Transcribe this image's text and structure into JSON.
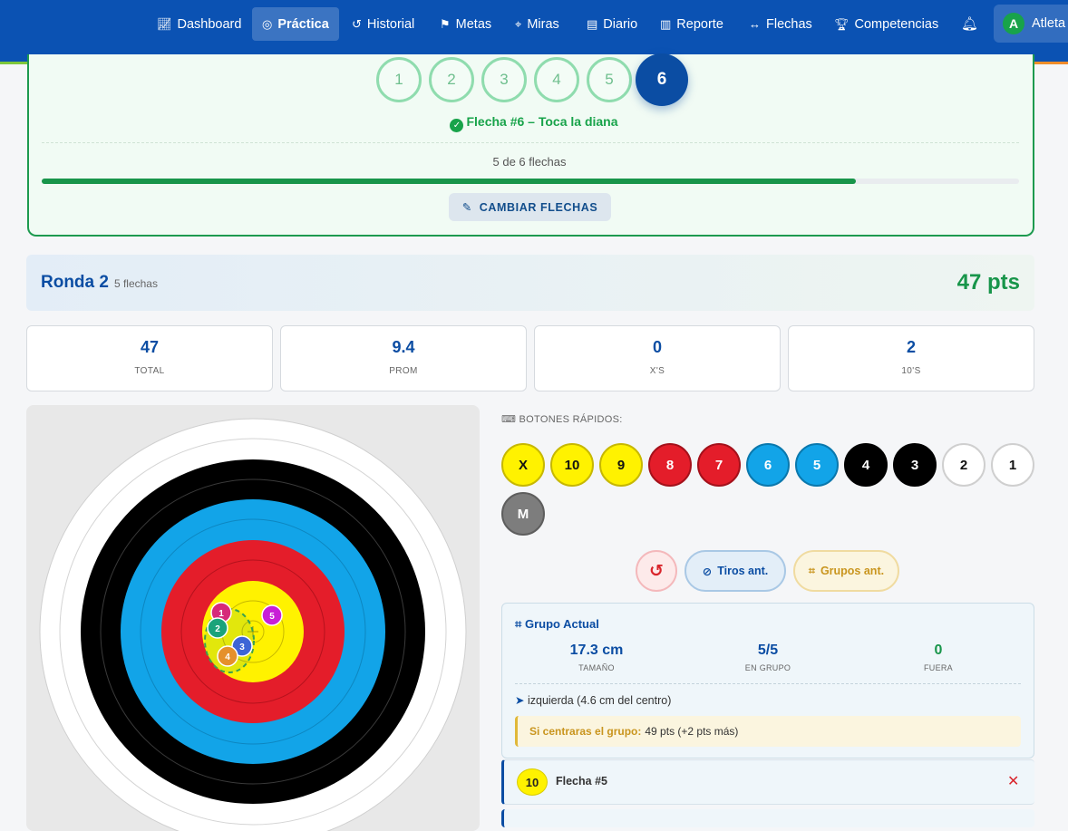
{
  "nav": {
    "items": [
      {
        "label": "Dashboard",
        "icon": "chart-line-icon"
      },
      {
        "label": "Práctica",
        "icon": "target-icon",
        "active": true
      },
      {
        "label": "Historial",
        "icon": "history-icon"
      },
      {
        "label": "Metas",
        "icon": "flag-checkered-icon"
      },
      {
        "label": "Miras",
        "icon": "crosshairs-icon"
      },
      {
        "label": "Diario",
        "icon": "book-icon"
      },
      {
        "label": "Reporte",
        "icon": "chart-bar-icon"
      },
      {
        "label": "Flechas",
        "icon": "arrows-horizontal-icon"
      },
      {
        "label": "Competencias",
        "icon": "trophy-icon"
      }
    ],
    "user": {
      "initial": "A",
      "name": "Atleta"
    }
  },
  "arrow_selector": {
    "arrows": [
      "1",
      "2",
      "3",
      "4",
      "5",
      "6"
    ],
    "current_index": 5,
    "status": "Flecha #6 – Toca la diana",
    "progress_text": "5 de 6 flechas",
    "progress_fraction": 0.833,
    "change_button": "CAMBIAR FLECHAS"
  },
  "round": {
    "title": "Ronda 2",
    "subtitle": "5 flechas",
    "points": "47 pts"
  },
  "stats": [
    {
      "value": "47",
      "label": "TOTAL"
    },
    {
      "value": "9.4",
      "label": "PROM"
    },
    {
      "value": "0",
      "label": "X'S"
    },
    {
      "value": "2",
      "label": "10'S"
    }
  ],
  "target": {
    "shots": [
      {
        "label": "1",
        "color": "#d6297a"
      },
      {
        "label": "2",
        "color": "#1aa37a"
      },
      {
        "label": "3",
        "color": "#3d65d6"
      },
      {
        "label": "4",
        "color": "#e5902b"
      },
      {
        "label": "5",
        "color": "#c81fd6"
      }
    ]
  },
  "quick_buttons": {
    "label": "BOTONES RÁPIDOS:",
    "buttons": [
      {
        "label": "X",
        "bg": "#fff200",
        "border": "#c7b800",
        "fg": "#111"
      },
      {
        "label": "10",
        "bg": "#fff200",
        "border": "#c7b800",
        "fg": "#111"
      },
      {
        "label": "9",
        "bg": "#fff200",
        "border": "#c7b800",
        "fg": "#111"
      },
      {
        "label": "8",
        "bg": "#e41d2a",
        "border": "#a4111b",
        "fg": "#fff"
      },
      {
        "label": "7",
        "bg": "#e41d2a",
        "border": "#a4111b",
        "fg": "#fff"
      },
      {
        "label": "6",
        "bg": "#12a4e8",
        "border": "#0a78ad",
        "fg": "#fff"
      },
      {
        "label": "5",
        "bg": "#12a4e8",
        "border": "#0a78ad",
        "fg": "#fff"
      },
      {
        "label": "4",
        "bg": "#000000",
        "border": "#000000",
        "fg": "#fff"
      },
      {
        "label": "3",
        "bg": "#000000",
        "border": "#000000",
        "fg": "#fff"
      },
      {
        "label": "2",
        "bg": "#ffffff",
        "border": "#cfcfcf",
        "fg": "#111"
      },
      {
        "label": "1",
        "bg": "#ffffff",
        "border": "#cfcfcf",
        "fg": "#111"
      },
      {
        "label": "M",
        "bg": "#7d7d7d",
        "border": "#5e5e5e",
        "fg": "#fff"
      }
    ]
  },
  "tools": {
    "undo_icon": "undo-icon",
    "prev_shots": "Tiros ant.",
    "prev_groups": "Grupos ant."
  },
  "group": {
    "title": "Grupo Actual",
    "size": {
      "value": "17.3 cm",
      "label": "TAMAÑO",
      "color": "#0b4da3"
    },
    "in_group": {
      "value": "5/5",
      "label": "EN GRUPO",
      "color": "#0b4da3"
    },
    "outside": {
      "value": "0",
      "label": "FUERA",
      "color": "#18954a"
    },
    "direction": "izquierda (4.6 cm del centro)",
    "hint_label": "Si centraras el grupo:",
    "hint_value": "49 pts (+2 pts más)"
  },
  "arrow_list": [
    {
      "score": "10",
      "label": "Flecha #5"
    }
  ]
}
